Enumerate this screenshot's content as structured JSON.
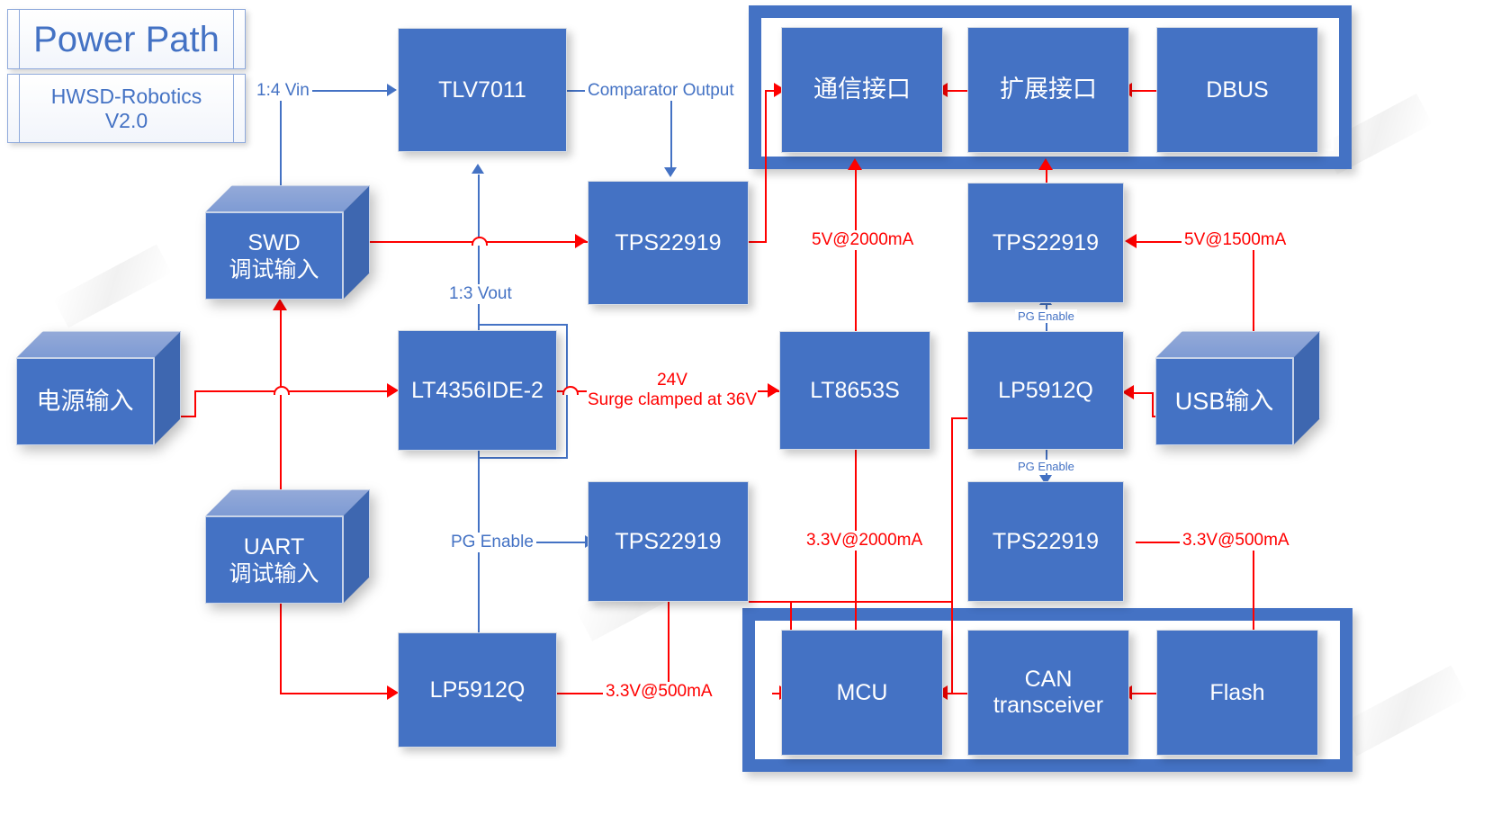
{
  "title": {
    "main": "Power Path",
    "sub_line1": "HWSD-Robotics",
    "sub_line2": "V2.0"
  },
  "blocks": {
    "tlv7011": "TLV7011",
    "tps22919_top": "TPS22919",
    "lt4356": "LT4356IDE-2",
    "lt8653s": "LT8653S",
    "lp5912q_right": "LP5912Q",
    "tps22919_right_top": "TPS22919",
    "tps22919_right_bottom": "TPS22919",
    "tps22919_bottom": "TPS22919",
    "lp5912q_bottom": "LP5912Q",
    "comm_interface": "通信接口",
    "expansion_interface": "扩展接口",
    "dbus": "DBUS",
    "mcu": "MCU",
    "can_transceiver_line1": "CAN",
    "can_transceiver_line2": "transceiver",
    "flash": "Flash"
  },
  "cubes": {
    "swd_line1": "SWD",
    "swd_line2": "调试输入",
    "power_in": "电源输入",
    "uart_line1": "UART",
    "uart_line2": "调试输入",
    "usb_in": "USB输入"
  },
  "labels": {
    "vin_ratio": "1:4 Vin",
    "vout_ratio": "1:3 Vout",
    "comparator_output": "Comparator Output",
    "surge_v": "24V",
    "surge_clamp": "Surge clamped at 36V",
    "pg_enable_left": "PG Enable",
    "pg_enable_right_top": "PG Enable",
    "pg_enable_right_bottom": "PG Enable",
    "rail_5v_2000": "5V@2000mA",
    "rail_5v_1500": "5V@1500mA",
    "rail_33v_2000": "3.3V@2000mA",
    "rail_33v_500_right": "3.3V@500mA",
    "rail_33v_500_bottom": "3.3V@500mA"
  },
  "colors": {
    "block_blue": "#4472C4",
    "power_red": "#FF0000",
    "frame_blue": "#4472C4",
    "cube_top": "#7E9BD4",
    "cube_side": "#3E67B0"
  }
}
